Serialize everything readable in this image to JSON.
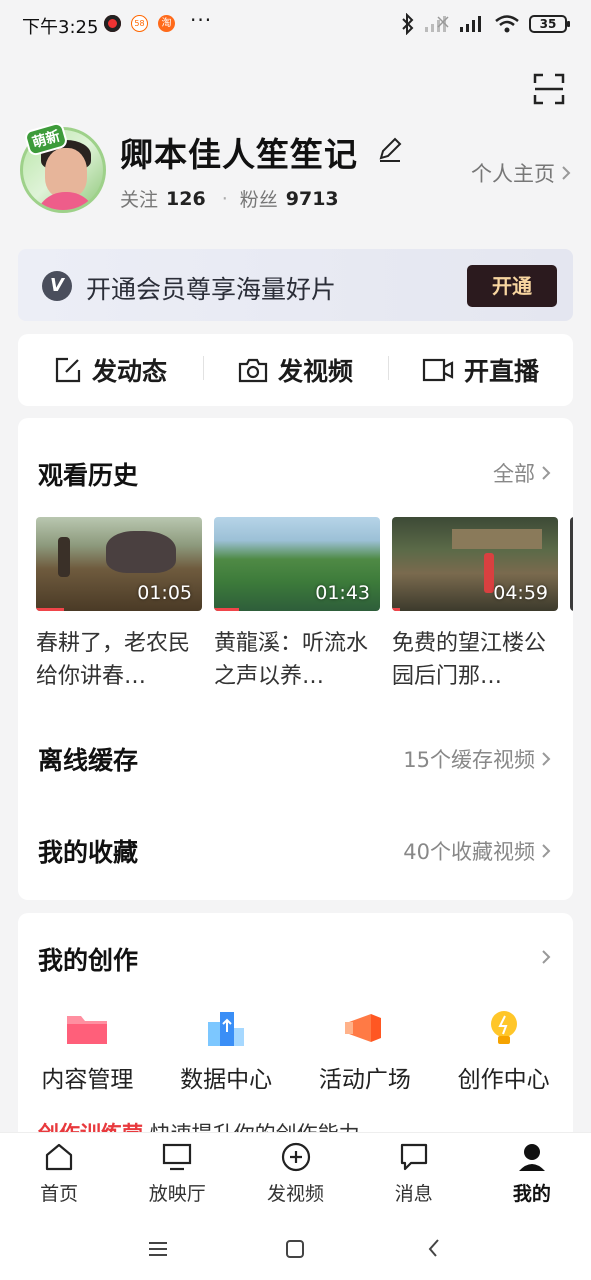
{
  "status_bar": {
    "time": "下午3:25",
    "more": "···",
    "battery": "35"
  },
  "profile": {
    "badge": "萌新",
    "name": "卿本佳人笙笙记",
    "following_label": "关注",
    "following_count": "126",
    "fans_label": "粉丝",
    "fans_count": "9713",
    "homepage_link": "个人主页"
  },
  "vip_banner": {
    "icon": "V",
    "text": "开通会员尊享海量好片",
    "button": "开通"
  },
  "actions": [
    {
      "label": "发动态",
      "icon": "edit-square-icon"
    },
    {
      "label": "发视频",
      "icon": "camera-icon"
    },
    {
      "label": "开直播",
      "icon": "video-camera-icon"
    }
  ],
  "history": {
    "title": "观看历史",
    "all_link": "全部",
    "items": [
      {
        "duration": "01:05",
        "title": "春耕了，老农民给你讲春…",
        "progress": 0.17
      },
      {
        "duration": "01:43",
        "title": "黄龍溪：听流水之声以养…",
        "progress": 0.15
      },
      {
        "duration": "04:59",
        "title": "免费的望江楼公园后门那…",
        "progress": 0.05
      }
    ]
  },
  "offline_cache": {
    "title": "离线缓存",
    "detail": "15个缓存视频"
  },
  "favorites": {
    "title": "我的收藏",
    "detail": "40个收藏视频"
  },
  "creation": {
    "title": "我的创作",
    "tools": [
      {
        "label": "内容管理",
        "icon": "folder-icon"
      },
      {
        "label": "数据中心",
        "icon": "data-chart-icon"
      },
      {
        "label": "活动广场",
        "icon": "megaphone-icon"
      },
      {
        "label": "创作中心",
        "icon": "lightbulb-icon"
      }
    ],
    "promo_red": "创作训练营",
    "promo_text": "快速提升你的创作能力"
  },
  "bottom_nav": [
    {
      "label": "首页",
      "icon": "home-icon",
      "active": false
    },
    {
      "label": "放映厅",
      "icon": "tv-icon",
      "active": false
    },
    {
      "label": "发视频",
      "icon": "plus-circle-icon",
      "active": false
    },
    {
      "label": "消息",
      "icon": "message-icon",
      "active": false
    },
    {
      "label": "我的",
      "icon": "person-icon",
      "active": true
    }
  ],
  "colors": {
    "accent_red": "#e8393d",
    "vip_button_bg": "#2b1a1e",
    "vip_button_text": "#f7d5a0"
  }
}
